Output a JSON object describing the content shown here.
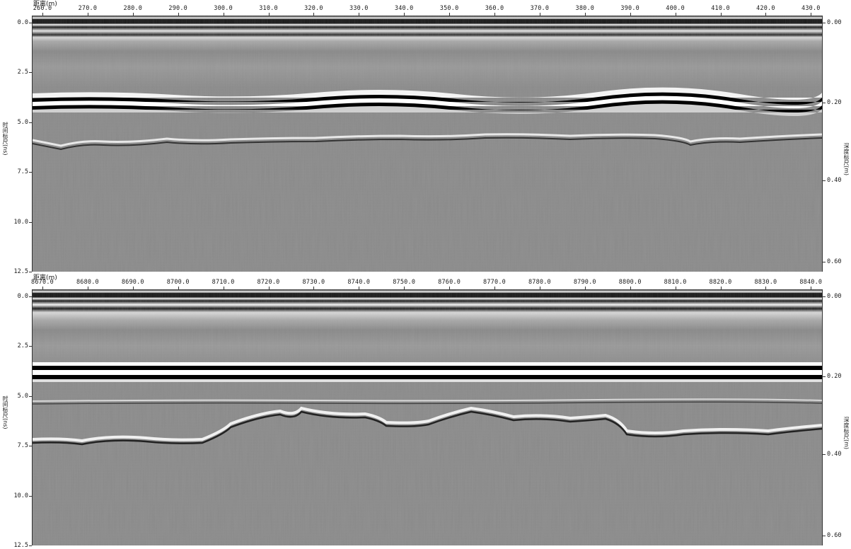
{
  "panels": [
    {
      "x_label": "距离(m)",
      "x_ticks": [
        "260.0",
        "270.0",
        "280.0",
        "290.0",
        "300.0",
        "310.0",
        "320.0",
        "330.0",
        "340.0",
        "350.0",
        "360.0",
        "370.0",
        "380.0",
        "390.0",
        "400.0",
        "410.0",
        "420.0",
        "430.0"
      ],
      "y_title": "时间标尺(ns)",
      "y_ticks": [
        "0.0",
        "2.5",
        "5.0",
        "7.5",
        "10.0",
        "12.5"
      ],
      "depth_title": "深度标尺(m)",
      "depth_ticks": [
        "0.00",
        "0.20",
        "0.40",
        "0.60"
      ]
    },
    {
      "x_label": "距离(m)",
      "x_ticks": [
        "8670.0",
        "8680.0",
        "8690.0",
        "8700.0",
        "8710.0",
        "8720.0",
        "8730.0",
        "8740.0",
        "8750.0",
        "8760.0",
        "8770.0",
        "8780.0",
        "8790.0",
        "8800.0",
        "8810.0",
        "8820.0",
        "8830.0",
        "8840.0"
      ],
      "y_title": "时间标尺(ns)",
      "y_ticks": [
        "0.0",
        "2.5",
        "5.0",
        "7.5",
        "10.0",
        "12.5"
      ],
      "depth_title": "深度标尺(m)",
      "depth_ticks": [
        "0.00",
        "0.20",
        "0.40",
        "0.60"
      ]
    }
  ],
  "colors": {
    "background": "#7f7f7f",
    "dark": "#000000",
    "light": "#ffffff"
  }
}
